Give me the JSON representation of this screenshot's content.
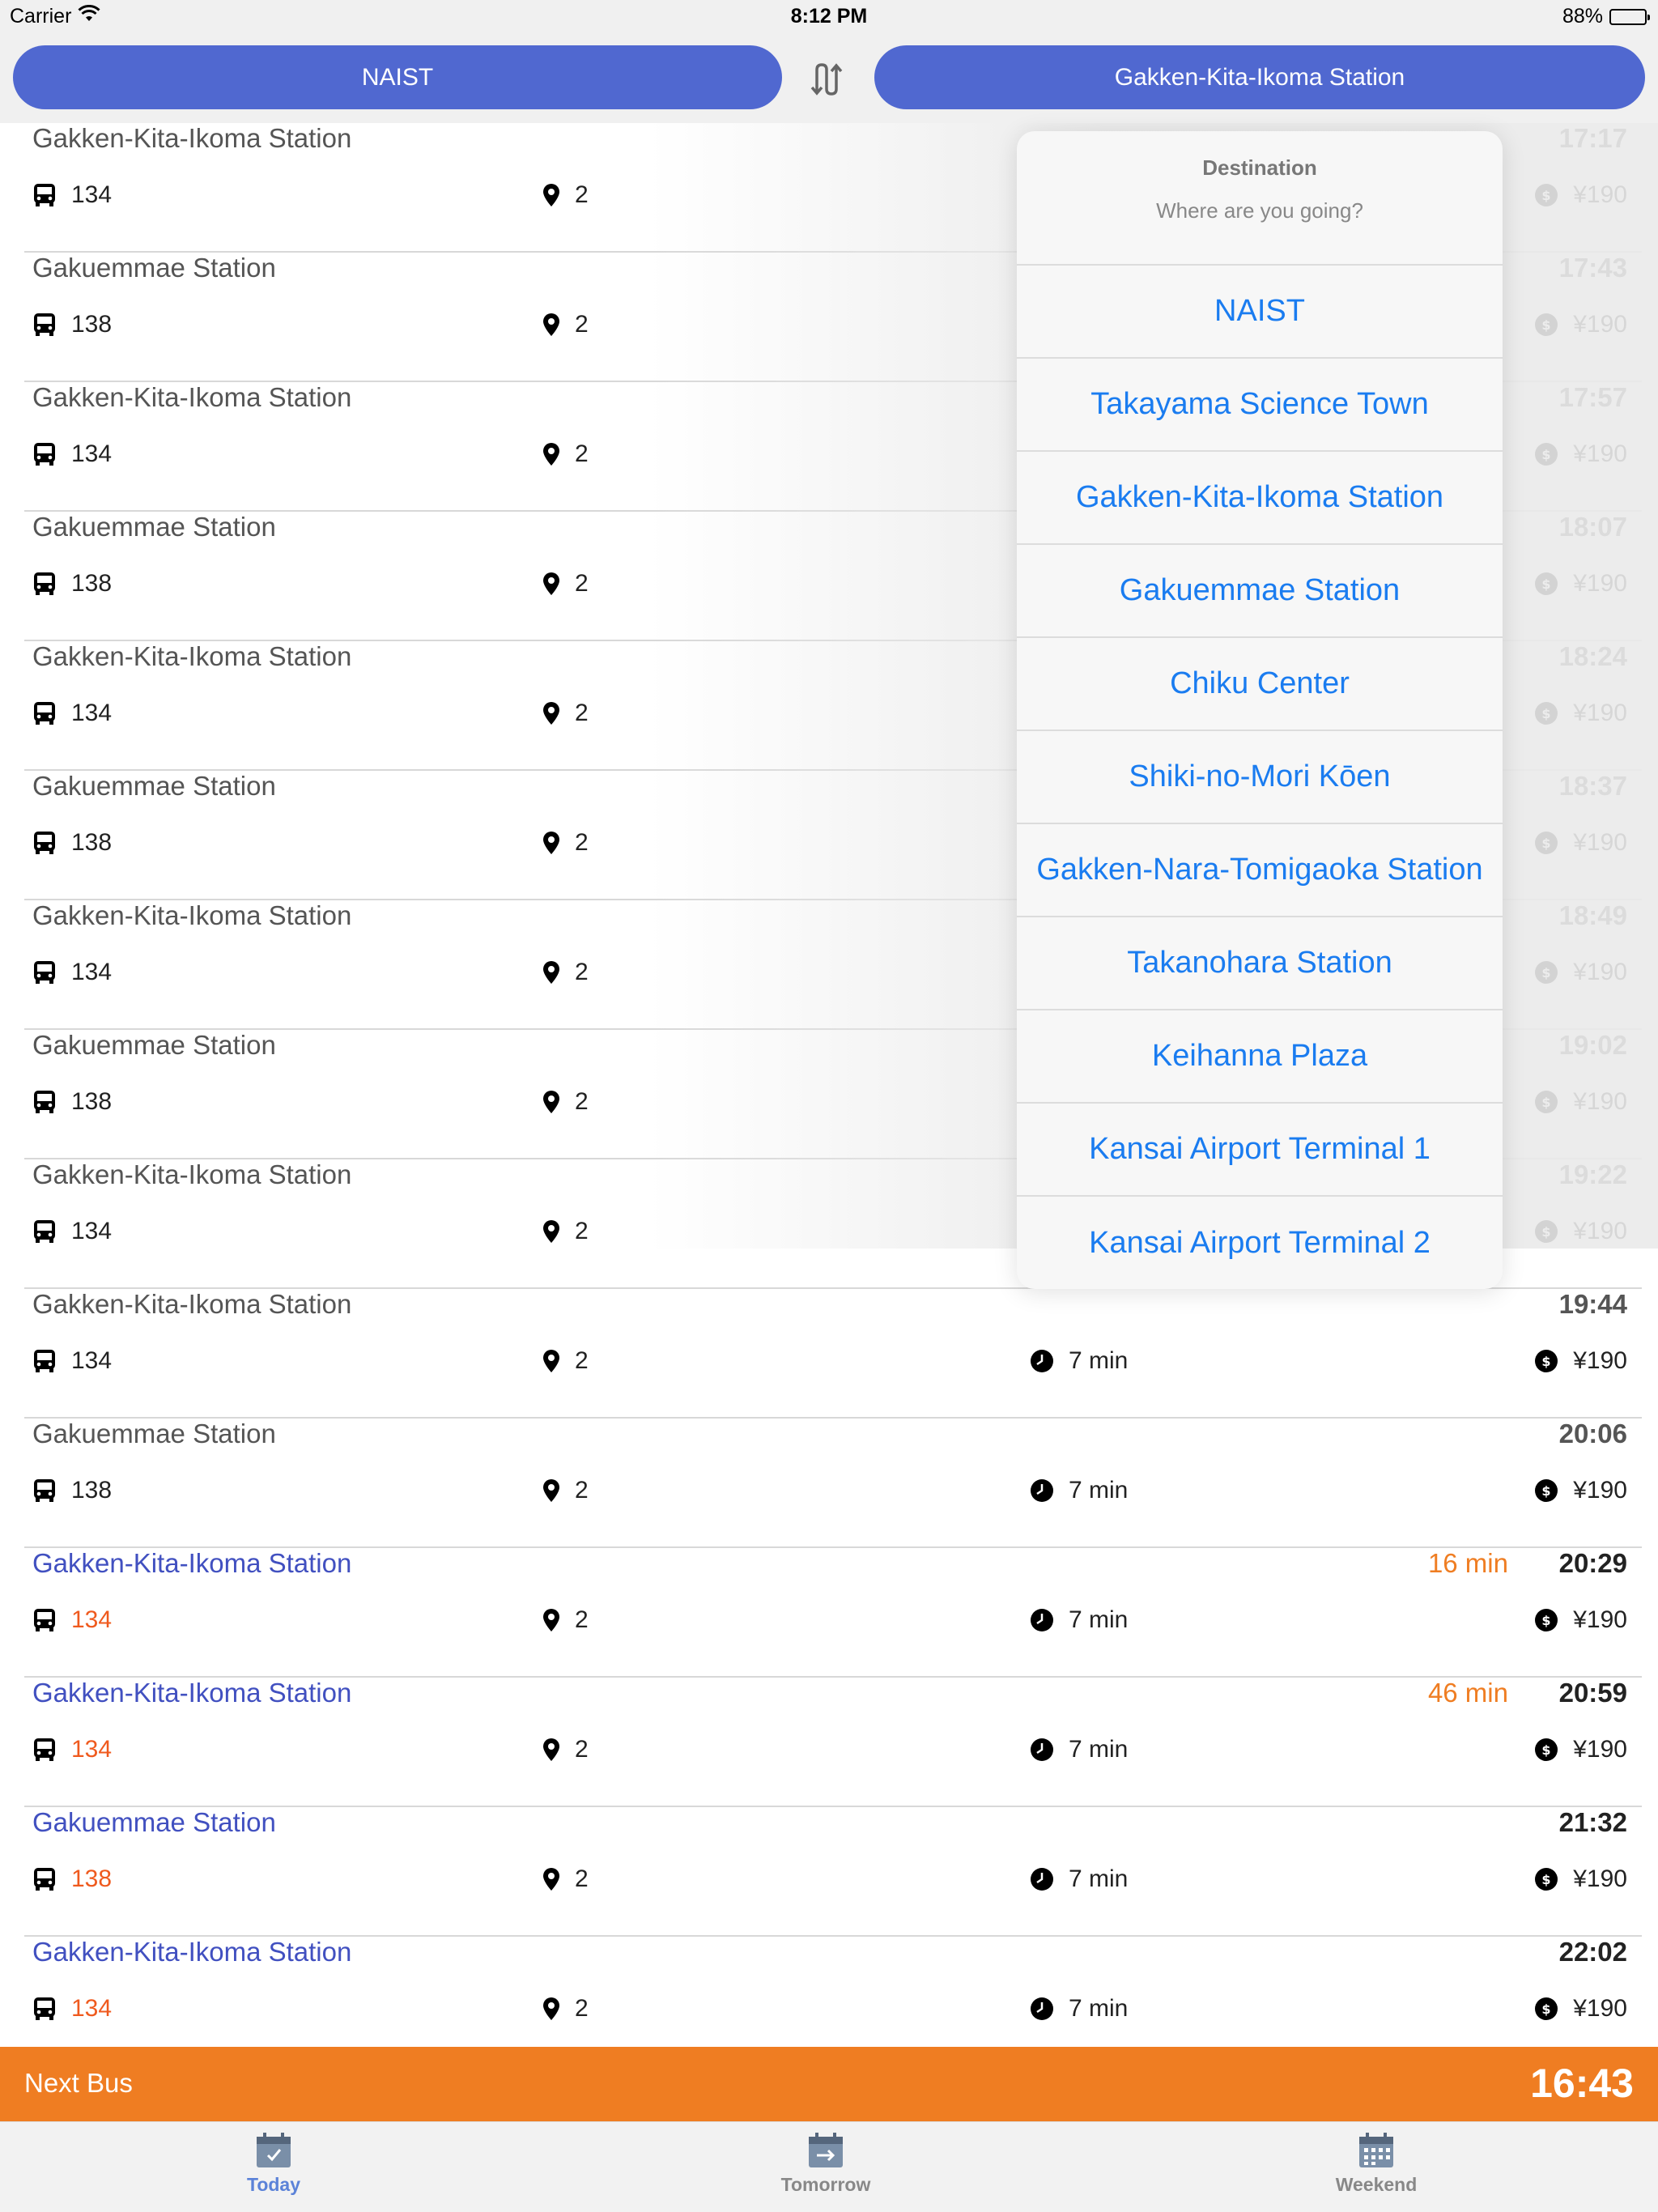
{
  "status_bar": {
    "carrier": "Carrier",
    "time": "8:12 PM",
    "battery": "88%",
    "battery_level": 0.88
  },
  "header": {
    "from": "NAIST",
    "to": "Gakken-Kita-Ikoma Station"
  },
  "rows": [
    {
      "dest": "Gakken-Kita-Ikoma Station",
      "time": "17:17",
      "eta": "",
      "bus": "134",
      "stop": "2",
      "duration": "",
      "fare": "¥190",
      "upcoming": false
    },
    {
      "dest": "Gakuemmae Station",
      "time": "17:43",
      "eta": "",
      "bus": "138",
      "stop": "2",
      "duration": "",
      "fare": "¥190",
      "upcoming": false
    },
    {
      "dest": "Gakken-Kita-Ikoma Station",
      "time": "17:57",
      "eta": "",
      "bus": "134",
      "stop": "2",
      "duration": "",
      "fare": "¥190",
      "upcoming": false
    },
    {
      "dest": "Gakuemmae Station",
      "time": "18:07",
      "eta": "",
      "bus": "138",
      "stop": "2",
      "duration": "",
      "fare": "¥190",
      "upcoming": false
    },
    {
      "dest": "Gakken-Kita-Ikoma Station",
      "time": "18:24",
      "eta": "",
      "bus": "134",
      "stop": "2",
      "duration": "",
      "fare": "¥190",
      "upcoming": false
    },
    {
      "dest": "Gakuemmae Station",
      "time": "18:37",
      "eta": "",
      "bus": "138",
      "stop": "2",
      "duration": "",
      "fare": "¥190",
      "upcoming": false
    },
    {
      "dest": "Gakken-Kita-Ikoma Station",
      "time": "18:49",
      "eta": "",
      "bus": "134",
      "stop": "2",
      "duration": "",
      "fare": "¥190",
      "upcoming": false
    },
    {
      "dest": "Gakuemmae Station",
      "time": "19:02",
      "eta": "",
      "bus": "138",
      "stop": "2",
      "duration": "",
      "fare": "¥190",
      "upcoming": false
    },
    {
      "dest": "Gakken-Kita-Ikoma Station",
      "time": "19:22",
      "eta": "",
      "bus": "134",
      "stop": "2",
      "duration": "",
      "fare": "¥190",
      "upcoming": false
    },
    {
      "dest": "Gakken-Kita-Ikoma Station",
      "time": "19:44",
      "eta": "",
      "bus": "134",
      "stop": "2",
      "duration": "7 min",
      "fare": "¥190",
      "upcoming": false
    },
    {
      "dest": "Gakuemmae Station",
      "time": "20:06",
      "eta": "",
      "bus": "138",
      "stop": "2",
      "duration": "7 min",
      "fare": "¥190",
      "upcoming": false
    },
    {
      "dest": "Gakken-Kita-Ikoma Station",
      "time": "20:29",
      "eta": "16 min",
      "bus": "134",
      "stop": "2",
      "duration": "7 min",
      "fare": "¥190",
      "upcoming": true
    },
    {
      "dest": "Gakken-Kita-Ikoma Station",
      "time": "20:59",
      "eta": "46 min",
      "bus": "134",
      "stop": "2",
      "duration": "7 min",
      "fare": "¥190",
      "upcoming": true
    },
    {
      "dest": "Gakuemmae Station",
      "time": "21:32",
      "eta": "",
      "bus": "138",
      "stop": "2",
      "duration": "7 min",
      "fare": "¥190",
      "upcoming": true
    },
    {
      "dest": "Gakken-Kita-Ikoma Station",
      "time": "22:02",
      "eta": "",
      "bus": "134",
      "stop": "2",
      "duration": "7 min",
      "fare": "¥190",
      "upcoming": true
    }
  ],
  "popover": {
    "title": "Destination",
    "subtitle": "Where are you going?",
    "options": [
      "NAIST",
      "Takayama Science Town",
      "Gakken-Kita-Ikoma Station",
      "Gakuemmae Station",
      "Chiku Center",
      "Shiki-no-Mori Kōen",
      "Gakken-Nara-Tomigaoka Station",
      "Takanohara Station",
      "Keihanna Plaza",
      "Kansai Airport Terminal 1",
      "Kansai Airport Terminal 2"
    ]
  },
  "next_bus": {
    "label": "Next Bus",
    "time": "16:43"
  },
  "tabs": [
    {
      "label": "Today",
      "icon": "calendar-check-icon",
      "active": true
    },
    {
      "label": "Tomorrow",
      "icon": "calendar-arrow-icon",
      "active": false
    },
    {
      "label": "Weekend",
      "icon": "calendar-grid-icon",
      "active": false
    }
  ],
  "colors": {
    "accent_blue": "#5068d0",
    "link_blue": "#1a7cf0",
    "orange": "#ef7d22",
    "route_orange": "#ef5a1e",
    "upcoming_text": "#4150c0"
  }
}
